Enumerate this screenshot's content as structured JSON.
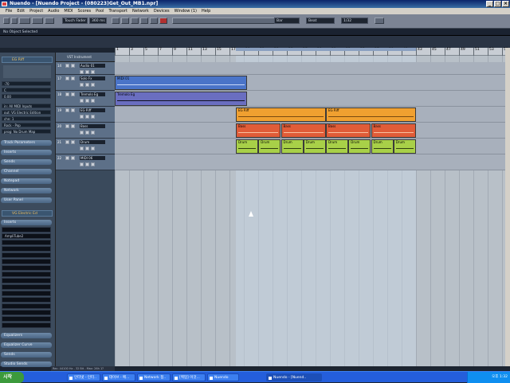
{
  "window": {
    "title": "Nuendo - [Nuendo Project - (080223)Get_Out_MB1.npr]"
  },
  "menu": [
    "File",
    "Edit",
    "Project",
    "Audio",
    "MIDI",
    "Scores",
    "Pool",
    "Transport",
    "Network",
    "Devices",
    "Window (1)",
    "Help"
  ],
  "toolbar": {
    "touch_mode": "Touch Fader",
    "fader_val": "360 ms",
    "snap_mode": "Bar",
    "grid_type": "Beat",
    "quantize": "1/32"
  },
  "infoline": {
    "text": "No Object Selected"
  },
  "inspector": {
    "track_name": "EG Riff",
    "volume": "-70",
    "pan": "C",
    "delay": "0.00",
    "input": "in: All MIDI Inputs",
    "output": "out: VG Electric Edition",
    "channel": "chn: 1",
    "bank": "Rock - Pop",
    "program": "prog: No Drum Map",
    "sections": [
      "Track Parameters",
      "Inserts",
      "Sends",
      "Channel",
      "Notepad",
      "Network",
      "User Panel"
    ],
    "instrument": "VG Electric Ed",
    "sub_sections": [
      "Inserts"
    ],
    "insert_slot": "AmpliTube2",
    "bottom_sections": [
      "Equalizers",
      "Equalizer Curve",
      "Sends",
      "Studio Sends"
    ]
  },
  "track_header": {
    "label": "VST Instrument"
  },
  "tracks": [
    {
      "num": "14",
      "name": "Audio 01",
      "sub": "Stereo"
    },
    {
      "num": "17",
      "name": "Solo Fx"
    },
    {
      "num": "18",
      "name": "Tremolo Eg"
    },
    {
      "num": "19",
      "name": "EG Riff"
    },
    {
      "num": "20",
      "name": "Bass"
    },
    {
      "num": "21",
      "name": "Drum"
    },
    {
      "num": "22",
      "name": "MIDI 06"
    }
  ],
  "ruler_marks": [
    "1",
    "3",
    "5",
    "7",
    "9",
    "11",
    "13",
    "15",
    "17",
    "19",
    "21",
    "23",
    "25",
    "27",
    "29",
    "31",
    "33",
    "35",
    "37",
    "39",
    "41",
    "43",
    "45",
    "47",
    "49",
    "51",
    "53",
    "55"
  ],
  "parts": {
    "solo": "MIDI 01",
    "trem": "Tremolo Eg",
    "eg1": "EG Riff",
    "eg2": "EG Riff",
    "bass": [
      "Bass",
      "Bass",
      "Bass",
      "Bass"
    ],
    "drum": [
      "Drum",
      "Drum",
      "Drum",
      "Drum",
      "Drum",
      "Drum",
      "Drum",
      "Drum"
    ]
  },
  "status": {
    "text": "Rec: 44100 Hz - 32 Bit - Max: 26h 1?"
  },
  "taskbar": {
    "start": "시작",
    "tasks": [
      "인터넷 - 인터..",
      "데이브 - 메...",
      "Network 접..",
      "[백업] 이것...",
      "Nuendo",
      "Nuendo - [Nuend.."
    ],
    "clock": "오후 1:32"
  },
  "colors": {
    "solo": "#4a74c8",
    "trem": "#6a6ec0",
    "eg": "#f0a030",
    "bass": "#e05c38",
    "drum": "#a8d048"
  }
}
